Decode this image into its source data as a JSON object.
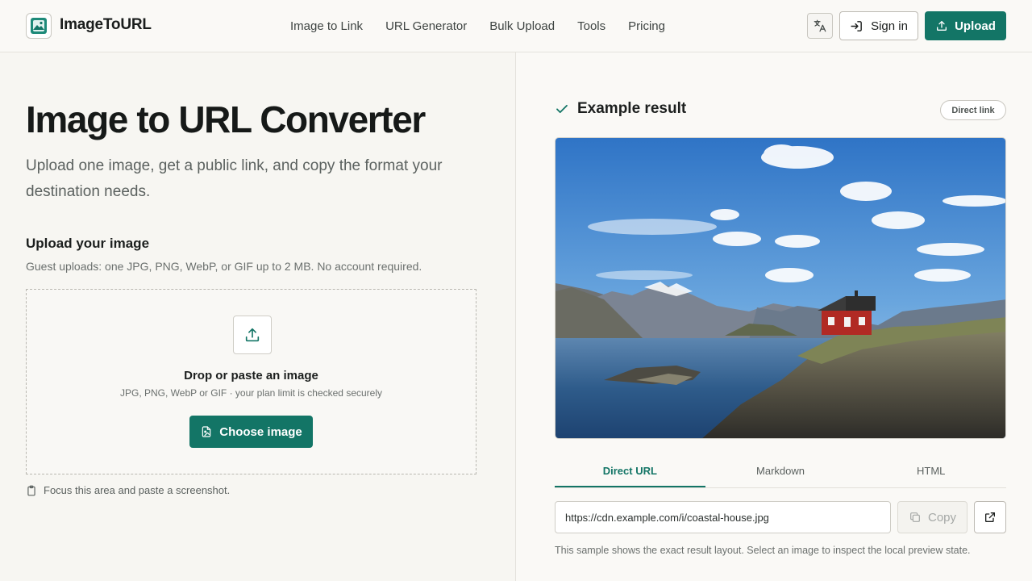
{
  "brand": {
    "name": "ImageToURL"
  },
  "nav": {
    "items": [
      {
        "label": "Image to Link"
      },
      {
        "label": "URL Generator"
      },
      {
        "label": "Bulk Upload"
      },
      {
        "label": "Tools"
      },
      {
        "label": "Pricing"
      }
    ]
  },
  "header": {
    "signin_label": "Sign in",
    "upload_label": "Upload"
  },
  "hero": {
    "title": "Image to URL Converter",
    "subtitle": "Upload one image, get a public link, and copy the format your destination needs."
  },
  "upload": {
    "heading": "Upload your image",
    "note": "Guest uploads: one JPG, PNG, WebP, or GIF up to 2 MB. No account required.",
    "drop_title": "Drop or paste an image",
    "drop_sub": "JPG, PNG, WebP or GIF · your plan limit is checked securely",
    "choose_label": "Choose image",
    "paste_hint": "Focus this area and paste a screenshot."
  },
  "result": {
    "heading": "Example result",
    "badge": "Direct link",
    "tabs": [
      {
        "label": "Direct URL",
        "active": true
      },
      {
        "label": "Markdown",
        "active": false
      },
      {
        "label": "HTML",
        "active": false
      }
    ],
    "url_value": "https://cdn.example.com/i/coastal-house.jpg",
    "copy_label": "Copy",
    "sample_note": "This sample shows the exact result layout. Select an image to inspect the local preview state."
  },
  "colors": {
    "accent": "#137566",
    "background": "#f9f8f5",
    "text": "#1c1f1e"
  },
  "icons": {
    "logo": "image-icon",
    "language": "translate-icon",
    "signin": "sign-in-icon",
    "upload": "upload-icon",
    "check": "check-icon",
    "file": "file-image-icon",
    "clipboard": "clipboard-icon",
    "copy": "copy-icon",
    "external": "external-link-icon"
  }
}
